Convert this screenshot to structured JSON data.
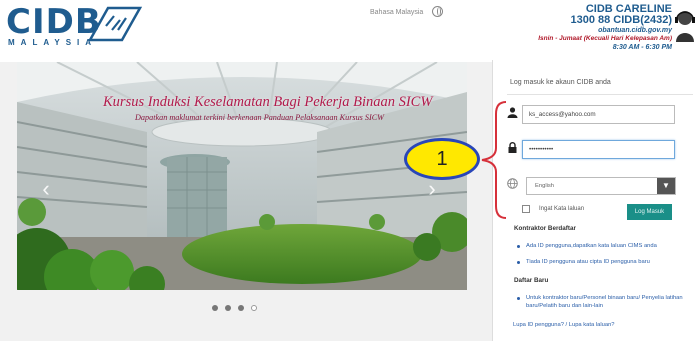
{
  "header": {
    "logo_text": "CIDB",
    "logo_sub": "MALAYSIA",
    "language_link": "Bahasa Malaysia",
    "careline": {
      "title": "CIDB CARELINE",
      "number": "1300 88 CIDB(2432)",
      "email": "obantuan.cidb.gov.my",
      "hours_days": "Isnin - Jumaat (Kecuali Hari Kelepasan Am)",
      "hours_time": "8:30 AM - 6:30 PM"
    }
  },
  "slider": {
    "title": "Kursus Induksi Keselamatan Bagi Pekerja Binaan SICW",
    "subtitle": "Dapatkan maklumat terkini berkenaan Panduan Pelaksanaan Kursus SICW",
    "prev_arrow": "‹",
    "next_arrow": "›",
    "dot_count": 4,
    "active_dot": 3
  },
  "annotation": {
    "label": "1"
  },
  "login": {
    "title": "Log masuk ke akaun CIDB anda",
    "username_value": "ks_access@yahoo.com",
    "password_value": "•••••••••••",
    "language_selected": "English",
    "remember_label": "Ingat Kata laluan",
    "login_button": "Log Masuk",
    "section_registered": "Kontraktor Berdaftar",
    "registered_links": [
      "Ada ID pengguna,dapatkan kata laluan CIMS anda",
      "Tiada ID pengguna atau cipta ID pengguna baru"
    ],
    "section_new": "Daftar Baru",
    "new_link": "Untuk kontraktor baru/Personel binaan baru/ Penyelia latihan baru/Pelatih baru dan lain-lain",
    "forgot": "Lupa ID pengguna? / Lupa kata laluan?"
  },
  "colors": {
    "brand_blue": "#1f5c8f",
    "title_red": "#b11a4b",
    "button_teal": "#1a8f88",
    "badge_yellow": "#ffe800",
    "badge_border": "#2946b8",
    "brace_red": "#d6303a"
  }
}
